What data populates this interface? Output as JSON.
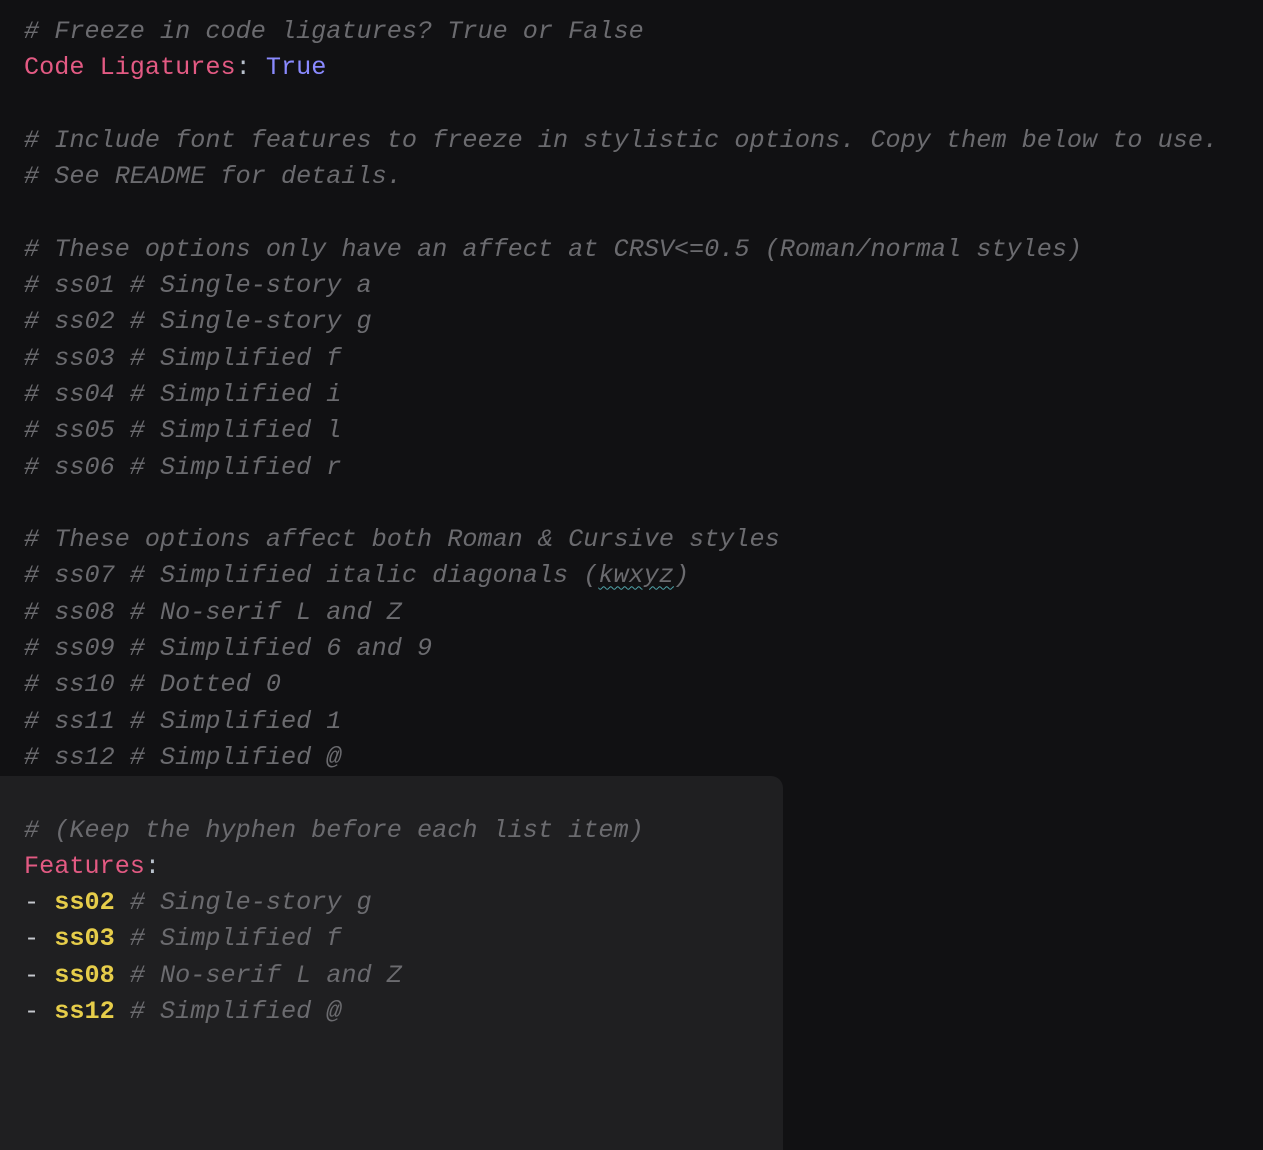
{
  "lines": {
    "c1": "# Freeze in code ligatures? True or False",
    "key1": "Code Ligatures",
    "colon": ":",
    "bool1": "True",
    "c2": "# Include font features to freeze in stylistic options. Copy them below to use.",
    "c3": "# See README for details.",
    "c4": "# These options only have an affect at CRSV<=0.5 (Roman/normal styles)",
    "c5": "# ss01 # Single-story a",
    "c6": "# ss02 # Single-story g",
    "c7": "# ss03 # Simplified f",
    "c8": "# ss04 # Simplified i",
    "c9": "# ss05 # Simplified l",
    "c10": "# ss06 # Simplified r",
    "c11": "# These options affect both Roman & Cursive styles",
    "c12a": "# ss07 # Simplified italic diagonals (",
    "c12b": "kwxyz",
    "c12c": ")",
    "c13": "# ss08 # No-serif L and Z",
    "c14": "# ss09 # Simplified 6 and 9",
    "c15": "# ss10 # Dotted 0",
    "c16": "# ss11 # Simplified 1",
    "c17": "# ss12 # Simplified @",
    "c18": "# (Keep the hyphen before each list item)",
    "key2": "Features",
    "dash": "- ",
    "f1": "ss02",
    "f1c": " # Single-story g",
    "f2": "ss03",
    "f2c": " # Simplified f",
    "f3": "ss08",
    "f3c": " # No-serif L and Z",
    "f4": "ss12",
    "f4c": " # Simplified @"
  }
}
